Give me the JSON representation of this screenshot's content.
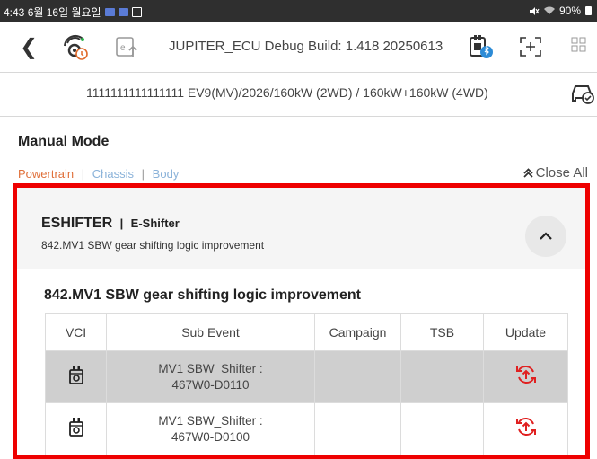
{
  "status_bar": {
    "time_date": "4:43  6월 16일 월요일",
    "battery": "90%"
  },
  "header": {
    "back_icon": "chevron-left-icon",
    "title": "JUPITER_ECU Debug Build: 1.418 20250613"
  },
  "vehicle": {
    "info": "1111111111111111  EV9(MV)/2026/160kW (2WD) / 160kW+160kW (4WD)"
  },
  "manual_mode": {
    "title": "Manual Mode",
    "filters": [
      "Powertrain",
      "Chassis",
      "Body"
    ],
    "separator": "|",
    "close_all": "Close All",
    "colors": {
      "active": "#e0703a",
      "inactive": "#8ab2d9",
      "highlight": "#ee0000",
      "update_icon": "#e02020"
    }
  },
  "card": {
    "name": "ESHIFTER",
    "divider": "|",
    "subname": "E-Shifter",
    "description": "842.MV1 SBW gear shifting logic improvement",
    "section_title": "842.MV1 SBW gear shifting logic improvement",
    "table": {
      "headers": [
        "VCI",
        "Sub Event",
        "Campaign",
        "TSB",
        "Update"
      ],
      "rows": [
        {
          "sub_event_line1": "MV1 SBW_Shifter :",
          "sub_event_line2": "467W0-D0110",
          "campaign": "",
          "tsb": "",
          "selected": true
        },
        {
          "sub_event_line1": "MV1 SBW_Shifter :",
          "sub_event_line2": "467W0-D0100",
          "campaign": "",
          "tsb": "",
          "selected": false
        }
      ]
    }
  }
}
